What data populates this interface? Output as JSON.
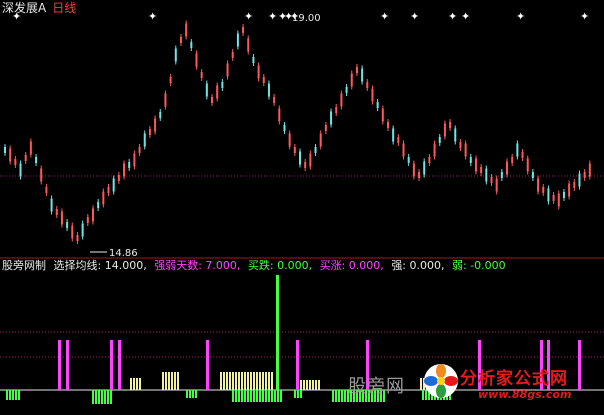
{
  "header": {
    "stock_name": "深发展A",
    "period": "日线"
  },
  "main_chart": {
    "high_label": "19.00",
    "low_label": "14.86",
    "colors": {
      "up": "#ff5a5a",
      "down": "#6fe6e6",
      "marker": "#ffffff",
      "dotline": "#a0206a"
    }
  },
  "indicator": {
    "name": "股旁网制",
    "params": [
      {
        "label": "选择均线: 14.000,",
        "color": "#e8e8e8"
      },
      {
        "label": "强弱天数: 7.000,",
        "color": "#ff44ff"
      },
      {
        "label": "买跌: 0.000,",
        "color": "#44ff44"
      },
      {
        "label": "买涨: 0.000,",
        "color": "#ff44ff"
      },
      {
        "label": "强: 0.000,",
        "color": "#e8e8e8"
      },
      {
        "label": "弱: -0.000",
        "color": "#44ff44"
      }
    ]
  },
  "watermark": {
    "left_text": "股旁网",
    "brand": "分析家公式网",
    "url": "www.88gs.com"
  }
}
